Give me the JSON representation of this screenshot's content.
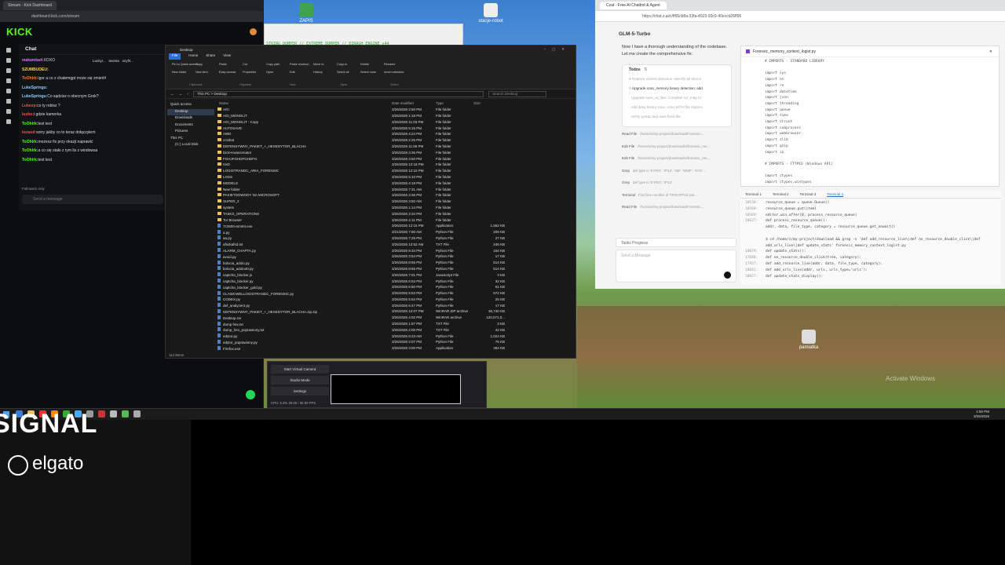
{
  "kick": {
    "tab_title": "Stream - Kick Dashboard",
    "url": "dashboard.kick.com/stream",
    "logo": "KICK",
    "chat_title": "Chat",
    "top_users": [
      "Lucky!...",
      "twoma",
      "ozyfir..."
    ],
    "messages": [
      {
        "user": "makamba4:",
        "text": "XOXO",
        "color": "#e56bf1"
      },
      {
        "user": "SZUMBUDEU:",
        "text": "",
        "color": "#ffd04a"
      },
      {
        "user": "ToOhlrk:",
        "text": "igor a co z chatemgpt może się zmień#",
        "color": "#ff7a29"
      },
      {
        "user": "LukeSpringu:",
        "text": "",
        "color": "#8ecbff"
      },
      {
        "user": "LukeSpringu:",
        "text": "Co sądzisz o obecnym Grok?",
        "color": "#8ecbff"
      },
      {
        "user": "Lukesp:",
        "text": "co ty robisz ?",
        "color": "#ff4d4d"
      },
      {
        "user": "lusbo:",
        "text": "i gdzie kamerka",
        "color": "#ff4d4d"
      },
      {
        "user": "ToOhlrk:",
        "text": "test test",
        "color": "#53fc18"
      },
      {
        "user": "kurasd:",
        "text": "sorry jakby co to teraz dołączyłem",
        "color": "#ff4d4d"
      },
      {
        "user": "ToOhlrk:",
        "text": "możesz fix przy okazji naprawić",
        "color": "#53fc18"
      },
      {
        "user": "ToOhlrk:",
        "text": "a co się stało z tym lis z windowsa",
        "color": "#53fc18"
      },
      {
        "user": "ToOhlrk:",
        "text": "test test",
        "color": "#53fc18"
      }
    ],
    "followers_only": "Followers only",
    "send_placeholder": "Send a message",
    "obs": {
      "start_virtual_camera": "Start Virtual Camera",
      "studio_mode": "Studio Mode",
      "settings": "Settings",
      "status": "CPU: 6.4%   30.00 / 30.00 FPS"
    }
  },
  "explorer": {
    "title": "Desktop",
    "menu": [
      "File",
      "Home",
      "Share",
      "View"
    ],
    "ribbon_groups": [
      "Clipboard",
      "Organize",
      "New",
      "Open",
      "Select"
    ],
    "ribbon_items": [
      "Pin to Quick access",
      "Copy",
      "Paste",
      "Cut",
      "Copy path",
      "Paste shortcut",
      "Move to",
      "Copy to",
      "Delete",
      "Rename",
      "New folder",
      "New item",
      "Easy access",
      "Properties",
      "Open",
      "Edit",
      "History",
      "Select all",
      "Select none",
      "Invert selection"
    ],
    "path": "This PC > Desktop",
    "search_placeholder": "Search Desktop",
    "nav": [
      "Quick access",
      "Desktop",
      "Downloads",
      "Documents",
      "Pictures",
      "This PC",
      "(C:) Local Disk"
    ],
    "columns": [
      "Name",
      "Date modified",
      "Type",
      "Size"
    ],
    "files": [
      {
        "name": "AGI",
        "date": "3/26/2026 2:50 PM",
        "type": "File folder",
        "size": "",
        "kind": "folder"
      },
      {
        "name": "AGI_MONOLIT",
        "date": "3/25/2026 1:18 PM",
        "type": "File folder",
        "size": "",
        "kind": "folder"
      },
      {
        "name": "AGI_MONOLIT - Copy",
        "date": "3/25/2026 11:03 PM",
        "type": "File folder",
        "size": "",
        "kind": "folder"
      },
      {
        "name": "AUTOSAVE",
        "date": "3/26/2026 5:15 PM",
        "type": "File folder",
        "size": "",
        "kind": "folder"
      },
      {
        "name": "AWD",
        "date": "3/26/2026 4:24 PM",
        "type": "File folder",
        "size": "",
        "kind": "folder"
      },
      {
        "name": "cctvbot",
        "date": "3/26/2026 2:26 PM",
        "type": "File folder",
        "size": "",
        "kind": "folder"
      },
      {
        "name": "DEFENSYWNY_PAKIET_+_HEXEDYTOR_BLACHA",
        "date": "3/26/2026 11:56 PM",
        "type": "File folder",
        "size": "",
        "kind": "folder"
      },
      {
        "name": "Dick-Kwaszenator",
        "date": "3/26/2026 3:36 PM",
        "type": "File folder",
        "size": "",
        "kind": "folder"
      },
      {
        "name": "FGHJFGHDFGHDFG",
        "date": "3/26/2026 3:50 PM",
        "type": "File folder",
        "size": "",
        "kind": "folder"
      },
      {
        "name": "HxD",
        "date": "3/26/2026 12:18 PM",
        "type": "File folder",
        "size": "",
        "kind": "folder"
      },
      {
        "name": "LOGISTRANDC_ARIA_FORENSIC",
        "date": "3/26/2026 12:10 PM",
        "type": "File folder",
        "size": "",
        "kind": "folder"
      },
      {
        "name": "LOSS",
        "date": "3/26/2026 5:10 PM",
        "type": "File folder",
        "size": "",
        "kind": "folder"
      },
      {
        "name": "MODELS",
        "date": "3/26/2026 4:18 PM",
        "type": "File folder",
        "size": "",
        "kind": "folder"
      },
      {
        "name": "New folder",
        "date": "3/26/2026 7:31 AM",
        "type": "File folder",
        "size": "",
        "kind": "folder"
      },
      {
        "name": "PAKIETDOWODY NA MICROSOFT",
        "date": "3/26/2026 3:36 PM",
        "type": "File folder",
        "size": "",
        "kind": "folder"
      },
      {
        "name": "SUPER_2",
        "date": "3/26/2026 3:50 AM",
        "type": "File folder",
        "size": "",
        "kind": "folder"
      },
      {
        "name": "system",
        "date": "3/26/2026 1:14 PM",
        "type": "File folder",
        "size": "",
        "kind": "folder"
      },
      {
        "name": "TASKS_OPERATIONS",
        "date": "3/26/2026 3:34 PM",
        "type": "File folder",
        "size": "",
        "kind": "folder"
      },
      {
        "name": "Tor Browser",
        "date": "3/26/2026 4:11 PM",
        "type": "File folder",
        "size": "",
        "kind": "folder"
      },
      {
        "name": "7z2600-arm64.exe",
        "date": "3/26/2026 12:15 PM",
        "type": "Application",
        "size": "1,552 KB",
        "kind": "file"
      },
      {
        "name": "a.py",
        "date": "3/21/2026 7:50 AM",
        "type": "Python File",
        "size": "209 KB",
        "kind": "file"
      },
      {
        "name": "aa.py",
        "date": "3/26/2026 7:25 PM",
        "type": "Python File",
        "size": "27 KB",
        "kind": "file"
      },
      {
        "name": "afsdsafsd.txt",
        "date": "3/25/2026 12:52 AM",
        "type": "TXT File",
        "size": "245 KB",
        "kind": "file"
      },
      {
        "name": "ALARM_CHAPTA.py",
        "date": "3/26/2026 8:34 PM",
        "type": "Python File",
        "size": "164 KB",
        "kind": "file"
      },
      {
        "name": "avoid.py",
        "date": "3/26/2026 3:54 PM",
        "type": "Python File",
        "size": "17 KB",
        "kind": "file"
      },
      {
        "name": "bolocia_adolo.py",
        "date": "3/26/2026 8:55 PM",
        "type": "Python File",
        "size": "514 KB",
        "kind": "file"
      },
      {
        "name": "bolocia_adolo40.py",
        "date": "3/26/2026 8:56 PM",
        "type": "Python File",
        "size": "514 KB",
        "kind": "file"
      },
      {
        "name": "captcha_blocker.js",
        "date": "3/26/2026 7:01 PM",
        "type": "JavaScript File",
        "size": "3 KB",
        "kind": "file"
      },
      {
        "name": "captcha_blocker.py",
        "date": "3/26/2026 6:53 PM",
        "type": "Python File",
        "size": "32 KB",
        "kind": "file"
      },
      {
        "name": "captcha_blocker_gold.py",
        "date": "3/26/2026 6:50 PM",
        "type": "Python File",
        "size": "61 KB",
        "kind": "file"
      },
      {
        "name": "CLAWCWELLOGISTRANDC_FORENSIC.py",
        "date": "3/26/2026 5:53 PM",
        "type": "Python File",
        "size": "672 KB",
        "kind": "file"
      },
      {
        "name": "CODEX.py",
        "date": "3/26/2026 5:52 PM",
        "type": "Python File",
        "size": "25 KB",
        "kind": "file"
      },
      {
        "name": "def_analyzer2.py",
        "date": "3/26/2026 6:47 PM",
        "type": "Python File",
        "size": "17 KB",
        "kind": "file"
      },
      {
        "name": "DEFENSYWNY_PAKIET_+_HEXEDYTOR_BLACHA.zip.zip",
        "date": "3/26/2026 10:07 PM",
        "type": "WinRAR ZIP archive",
        "size": "36,740 KB",
        "kind": "file"
      },
      {
        "name": "Desktop.rar",
        "date": "3/26/2026 4:02 PM",
        "type": "WinRAR archive",
        "size": "120,071,0...",
        "kind": "file"
      },
      {
        "name": "dump hex.txt",
        "date": "3/26/2026 1:57 PM",
        "type": "TXT File",
        "size": "3 KB",
        "kind": "file"
      },
      {
        "name": "dump_hex_poprawiony.txt",
        "date": "3/26/2026 2:00 PM",
        "type": "TXT File",
        "size": "42 KB",
        "kind": "file"
      },
      {
        "name": "edytor.py",
        "date": "3/26/2026 8:23 AM",
        "type": "Python File",
        "size": "1,024 KB",
        "kind": "file"
      },
      {
        "name": "edytor_poprawiony.py",
        "date": "3/26/2026 2:07 PM",
        "type": "Python File",
        "size": "76 KB",
        "kind": "file"
      },
      {
        "name": "Firefox.exe",
        "date": "3/26/2026 3:00 PM",
        "type": "Application",
        "size": "384 KB",
        "kind": "file"
      }
    ],
    "status": "114 items"
  },
  "chatwin": {
    "tab": "Czat - Free AI Chatbot & Agent",
    "url": "https://chat.z.ai/c/ff95cb8a-33fa-4923-93c9-40eccd26ff96",
    "model": "GLM-5-Turbo",
    "intro": "Now I have a thorough understanding of the codebase. Let me create the comprehensive fix:",
    "todos_title": "Todos",
    "todos_count": "5",
    "todos": [
      "Replace current detection -identify all device",
      "Upgrade scan_memory binary detection: add",
      "Upgrade save_at_files: complete scr_map to",
      "Add deep binary scan, scan WITH file regions",
      "Verify syntax and save fixed file"
    ],
    "tools": [
      {
        "label": "Read File",
        "arg": "/home/z/my-project/download/Forensic..."
      },
      {
        "label": "Edit File",
        "arg": "/home/z/my-project/download/4/forensic_me..."
      },
      {
        "label": "Edit File",
        "arg": "/home/z/my-project/download/4/forensic_me..."
      },
      {
        "label": "Grep",
        "arg": "def type in 'EYRO', 'IP13', 'GB', 'WMF', 'SVG'..."
      },
      {
        "label": "Grep",
        "arg": "def type in 'EYRO', 'IP13'"
      },
      {
        "label": "Terminal",
        "arg": "Find line number of TROUPPLE pat..."
      },
      {
        "label": "Read File",
        "arg": "/home/z/my-project/download/Forensic..."
      }
    ],
    "tasks_progress": "Tasks Progress",
    "message_placeholder": "Send a Message",
    "file_title": "Forensic_memory_context_logist.py",
    "code": [
      "# IMPORTS - STANDARD LIBRARY",
      "",
      "import sys",
      "import os",
      "import re",
      "import datetime",
      "import json",
      "import threading",
      "import queue",
      "import time",
      "import struct",
      "import subprocess",
      "import webbrowser",
      "import zlib",
      "import gzip",
      "import io",
      "",
      "# IMPORTS - CTYPES (Windows API)",
      "",
      "import ctypes",
      "import ctypes.wintypes"
    ],
    "terminal_tabs": [
      "Terminal 1",
      "Terminal 2",
      "Terminal 3",
      "Terminal 4"
    ],
    "terminal": [
      "resource_queue = queue.Queue()",
      "resource_queue.put(item)",
      "editor.win.after(0, process_resource_queue)",
      "def process_resource_queue():",
      "addr, data, file_type, category = resource_queue.get_nowait()",
      "",
      "$ cd /home/z/my-project/download && grep -n 'def add_resource_live\\|def on_resource_double_click\\|def",
      "add_urls_live\\|def update_stats' forensic_memory_context_logist.py",
      "def update_stats():",
      "def on_resource_double_click(tree, category):",
      "def add_resource_live(addr, data, file_type, category):",
      "def add_urls_live(addr, urls, urls_type='urls'):",
      "def update_stats_display():"
    ],
    "terminal_linenos": [
      "10536:",
      "10568:",
      "10569:",
      "10627:",
      "",
      "",
      "",
      "",
      "10079:",
      "17688:",
      "17937:",
      "18041:",
      "18027:"
    ]
  },
  "desktop": {
    "icons": [
      "ZAPIS",
      "stacje-robot",
      "pamiatka",
      "Desktop"
    ],
    "activate_windows": "Activate Windows",
    "clock_time": "1:50 PM",
    "clock_date": "3/26/2026"
  },
  "overlay": {
    "banner_text": "STRING DUMPER // EXTREME DUMPER // DIRAGH ENGINE v44",
    "signal_text": "SIGNAL",
    "elgato_text": "elgato"
  },
  "colors": {
    "kick_green": "#53fc18",
    "chat_accent": "#7c3aed"
  }
}
